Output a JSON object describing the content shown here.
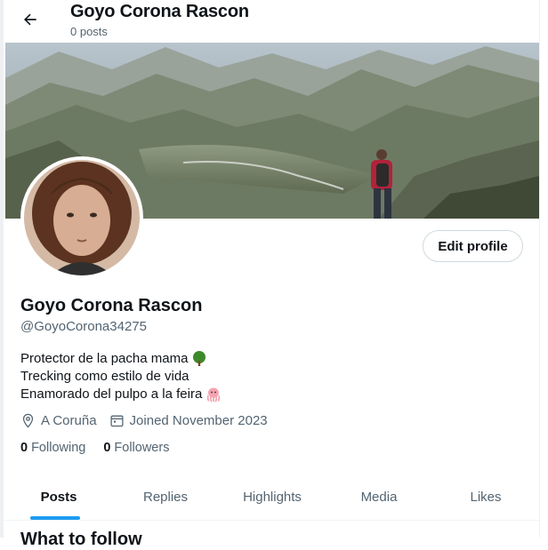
{
  "header": {
    "title": "Goyo Corona Rascon",
    "subtitle": "0 posts"
  },
  "profile": {
    "display_name": "Goyo Corona Rascon",
    "handle": "@GoyoCorona34275",
    "edit_profile_label": "Edit profile",
    "bio": [
      {
        "text": "Protector de la pacha mama",
        "emoji_icon": "tree-icon"
      },
      {
        "text": "Trecking como estilo de vida",
        "emoji_icon": null
      },
      {
        "text": "Enamorado del pulpo a la feira",
        "emoji_icon": "octopus-icon"
      }
    ],
    "location": "A Coruña",
    "joined": "Joined November 2023",
    "following_count": "0",
    "following_label": "Following",
    "followers_count": "0",
    "followers_label": "Followers"
  },
  "tabs": [
    {
      "label": "Posts",
      "active": true
    },
    {
      "label": "Replies",
      "active": false
    },
    {
      "label": "Highlights",
      "active": false
    },
    {
      "label": "Media",
      "active": false
    },
    {
      "label": "Likes",
      "active": false
    }
  ],
  "next_section_title": "What to follow",
  "colors": {
    "accent": "#1d9bf0",
    "text_primary": "#0f1419",
    "text_secondary": "#536471",
    "border": "#cfd9de"
  }
}
